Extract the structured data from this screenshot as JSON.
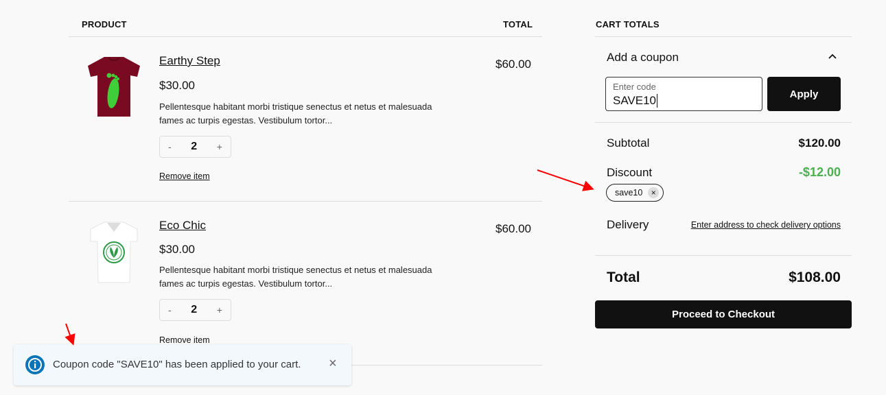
{
  "table": {
    "product_header": "PRODUCT",
    "total_header": "TOTAL"
  },
  "items": [
    {
      "name": "Earthy Step",
      "price": "$30.00",
      "description_1": "Pellentesque habitant morbi tristique senectus et netus et malesuada",
      "description_2": "fames ac turpis egestas. Vestibulum tortor...",
      "qty_minus": "-",
      "quantity": "2",
      "qty_plus": "+",
      "remove": "Remove item",
      "line_total": "$60.00",
      "image": "maroon-tshirt-footprint"
    },
    {
      "name": "Eco Chic",
      "price": "$30.00",
      "description_1": "Pellentesque habitant morbi tristique senectus et netus et malesuada",
      "description_2": "fames ac turpis egestas. Vestibulum tortor...",
      "qty_minus": "-",
      "quantity": "2",
      "qty_plus": "+",
      "remove": "Remove item",
      "line_total": "$60.00",
      "image": "white-tshirt-eco-badge"
    }
  ],
  "totals": {
    "title": "CART TOTALS",
    "coupon_toggle": "Add a coupon",
    "coupon_label": "Enter code",
    "coupon_value": "SAVE10",
    "apply": "Apply",
    "subtotal_label": "Subtotal",
    "subtotal": "$120.00",
    "discount_label": "Discount",
    "discount": "-$12.00",
    "discount_color": "#4caf50",
    "coupon_chip": "save10",
    "chip_remove": "×",
    "delivery_label": "Delivery",
    "delivery_link": "Enter address to check delivery options",
    "total_label": "Total",
    "total": "$108.00",
    "checkout": "Proceed to Checkout"
  },
  "notice": {
    "text": "Coupon code \"SAVE10\" has been applied to your cart.",
    "close": "×",
    "icon": "info-icon",
    "color": "#0a75b6"
  }
}
